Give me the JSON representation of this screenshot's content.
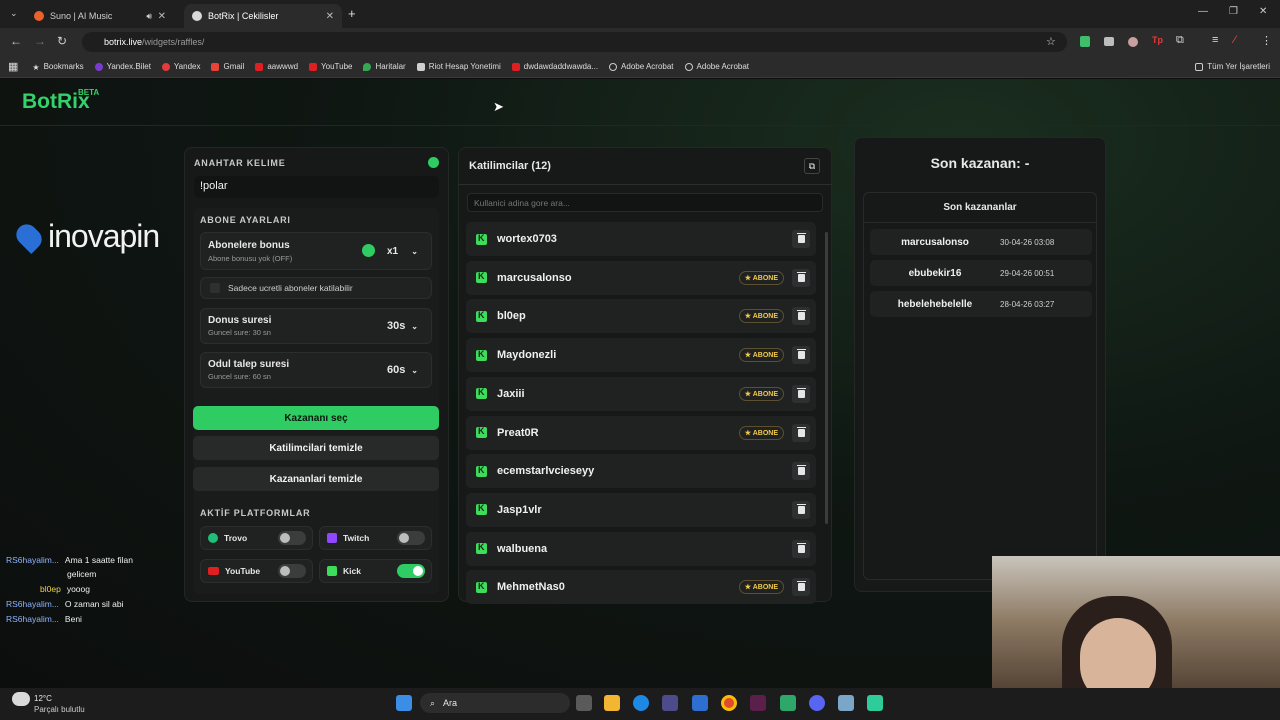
{
  "browser": {
    "tabs": [
      {
        "title": "Suno | AI Music"
      },
      {
        "title": "BotRix | Cekilisler"
      }
    ],
    "new_tab": "+",
    "url_host": "botrix.live",
    "url_path": "/widgets/raffles/",
    "bookmarks": [
      "Bookmarks",
      "Yandex.Bilet",
      "Yandex",
      "Gmail",
      "aawwwd",
      "YouTube",
      "Haritalar",
      "Riot Hesap Yonetimi",
      "dwdawdaddwawda...",
      "Adobe Acrobat",
      "Adobe Acrobat"
    ],
    "bookmarks_folder": "Tüm Yer İşaretleri"
  },
  "app": {
    "logo": "BotRix",
    "logo_badge": "BETA",
    "overlay_brand": "inovapin"
  },
  "settings": {
    "keyword_label": "ANAHTAR KELIME",
    "keyword_value": "!polar",
    "sub_settings_label": "ABONE AYARLARI",
    "sub_bonus_title": "Abonelere bonus",
    "sub_bonus_sub": "Abone bonusu yok (OFF)",
    "sub_bonus_value": "x1",
    "paid_only_label": "Sadece ucretli aboneler katilabilir",
    "spin_title": "Donus suresi",
    "spin_sub": "Guncel sure: 30 sn",
    "spin_value": "30s",
    "claim_title": "Odul talep suresi",
    "claim_sub": "Guncel sure: 60 sn",
    "claim_value": "60s",
    "pick_winner": "Kazananı seç",
    "clear_participants": "Katilimcilari temizle",
    "clear_winners": "Kazananlari temizle",
    "platforms_label": "AKTİF PLATFORMLAR",
    "platforms": [
      {
        "name": "Trovo",
        "on": false
      },
      {
        "name": "Twitch",
        "on": false
      },
      {
        "name": "YouTube",
        "on": false
      },
      {
        "name": "Kick",
        "on": true
      }
    ]
  },
  "participants": {
    "title": "Katilimcilar (12)",
    "search_placeholder": "Kullanici adina gore ara...",
    "badge_label": "ABONE",
    "list": [
      {
        "name": "wortex0703",
        "sub": false
      },
      {
        "name": "marcusalonso",
        "sub": true
      },
      {
        "name": "bl0ep",
        "sub": true
      },
      {
        "name": "Maydonezli",
        "sub": true
      },
      {
        "name": "Jaxiii",
        "sub": true
      },
      {
        "name": "Preat0R",
        "sub": true
      },
      {
        "name": "ecemstarlvcieseyy",
        "sub": false
      },
      {
        "name": "Jasp1vlr",
        "sub": false
      },
      {
        "name": "walbuena",
        "sub": false
      },
      {
        "name": "MehmetNas0",
        "sub": true
      }
    ]
  },
  "winners": {
    "last_winner": "Son kazanan: -",
    "recent_title": "Son kazananlar",
    "list": [
      {
        "name": "marcusalonso",
        "date": "30-04-26 03:08"
      },
      {
        "name": "ebubekir16",
        "date": "29-04-26 00:51"
      },
      {
        "name": "hebelehebelelle",
        "date": "28-04-26 03:27"
      }
    ]
  },
  "chat": [
    {
      "user": "RS6hayalim...",
      "msg": "Ama 1 saatte filan"
    },
    {
      "user": "",
      "msg": "gelicem"
    },
    {
      "user": "bl0ep",
      "msg": "yooog"
    },
    {
      "user": "RS6hayalim...",
      "msg": "O zaman sil abi"
    },
    {
      "user": "RS6hayalim...",
      "msg": "Beni"
    }
  ],
  "taskbar": {
    "weather_temp": "12°C",
    "weather_desc": "Parçalı bulutlu",
    "search": "Ara"
  },
  "colors": {
    "accent": "#2ecc62",
    "badge": "#f2c94c"
  }
}
